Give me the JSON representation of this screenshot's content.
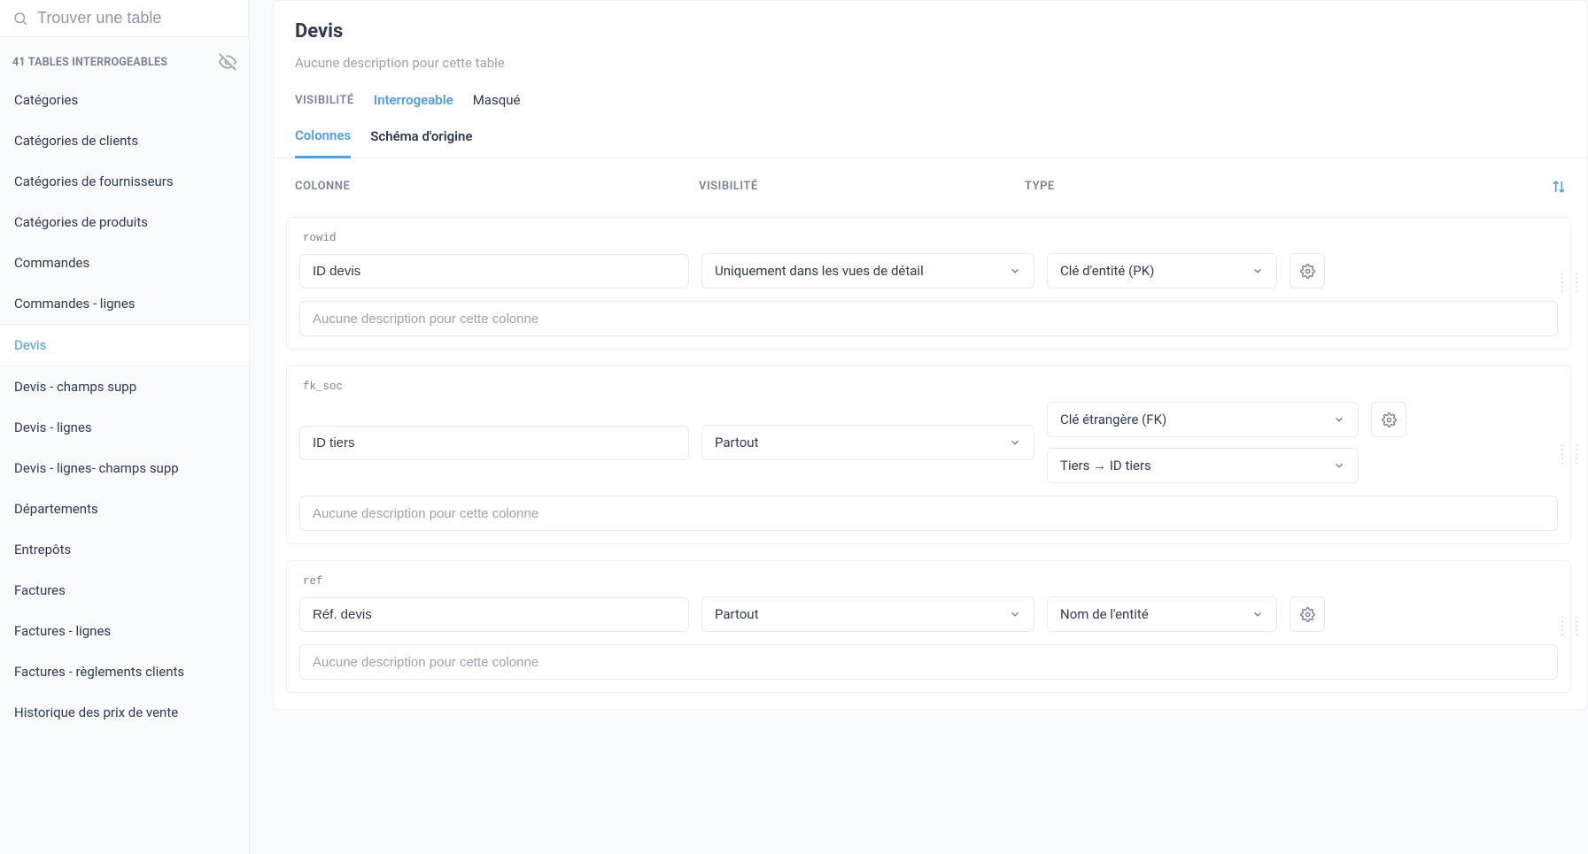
{
  "search": {
    "placeholder": "Trouver une table"
  },
  "sidebar_header": "41 TABLES INTERROGEABLES",
  "tables": [
    "Catégories",
    "Catégories de clients",
    "Catégories de fournisseurs",
    "Catégories de produits",
    "Commandes",
    "Commandes - lignes",
    "Devis",
    "Devis - champs supp",
    "Devis - lignes",
    "Devis - lignes- champs supp",
    "Départements",
    "Entrepôts",
    "Factures",
    "Factures - lignes",
    "Factures - règlements clients",
    "Historique des prix de vente"
  ],
  "active_table_index": 6,
  "page": {
    "title": "Devis",
    "description": "Aucune description pour cette table"
  },
  "visibility": {
    "label": "VISIBILITÉ",
    "options": [
      "Interrogeable",
      "Masqué"
    ],
    "active_index": 0
  },
  "tabs": {
    "items": [
      "Colonnes",
      "Schéma d'origine"
    ],
    "active_index": 0
  },
  "columns_header": {
    "name": "COLONNE",
    "visibility": "VISIBILITÉ",
    "type": "TYPE"
  },
  "column_description_placeholder": "Aucune description pour cette colonne",
  "columns": [
    {
      "db": "rowid",
      "name": "ID devis",
      "visibility": "Uniquement dans les vues de détail",
      "type": "Clé d'entité (PK)",
      "fk_target": null
    },
    {
      "db": "fk_soc",
      "name": "ID tiers",
      "visibility": "Partout",
      "type": "Clé étrangère (FK)",
      "fk_target": "Tiers → ID tiers"
    },
    {
      "db": "ref",
      "name": "Réf. devis",
      "visibility": "Partout",
      "type": "Nom de l'entité",
      "fk_target": null
    }
  ]
}
